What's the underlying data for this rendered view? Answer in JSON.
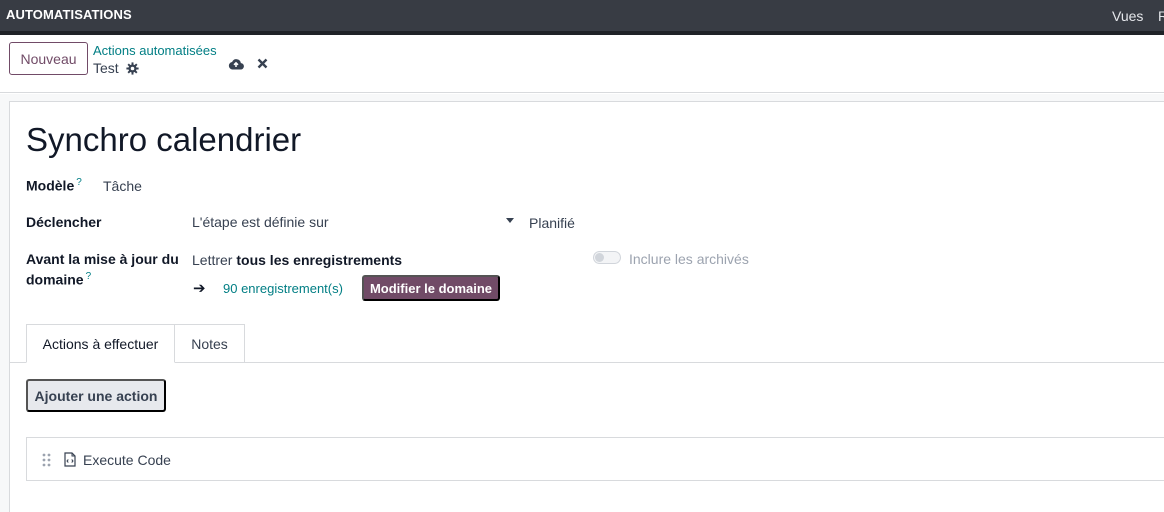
{
  "header": {
    "app_title": "AUTOMATISATIONS",
    "menu": [
      "Vues",
      "R"
    ]
  },
  "control_panel": {
    "new_button": "Nouveau",
    "breadcrumb": "Actions automatisées",
    "record_name": "Test",
    "icons": [
      "gear-icon",
      "cloud-upload-icon",
      "close-icon"
    ]
  },
  "form": {
    "title": "Synchro calendrier",
    "model": {
      "label": "Modèle",
      "help": "?",
      "value": "Tâche"
    },
    "trigger": {
      "label": "Déclencher",
      "value": "L'étape est définie sur",
      "stage": "Planifié"
    },
    "domain": {
      "label_line1": "Avant la mise à jour du",
      "label_line2": "domaine",
      "help": "?",
      "prefix": "Lettrer",
      "scope": "tous les enregistrements",
      "records": "90 enregistrement(s)",
      "edit_button": "Modifier le domaine",
      "archived_toggle": {
        "label": "Inclure les archivés",
        "checked": false
      }
    }
  },
  "tabs": [
    {
      "label": "Actions à effectuer",
      "active": true
    },
    {
      "label": "Notes",
      "active": false
    }
  ],
  "actions": {
    "add_button": "Ajouter une action",
    "items": [
      {
        "label": "Execute Code",
        "icon": "code-file-icon"
      }
    ]
  },
  "colors": {
    "navbar": "#383c44",
    "primary": "#714b67",
    "link": "#017e84"
  }
}
